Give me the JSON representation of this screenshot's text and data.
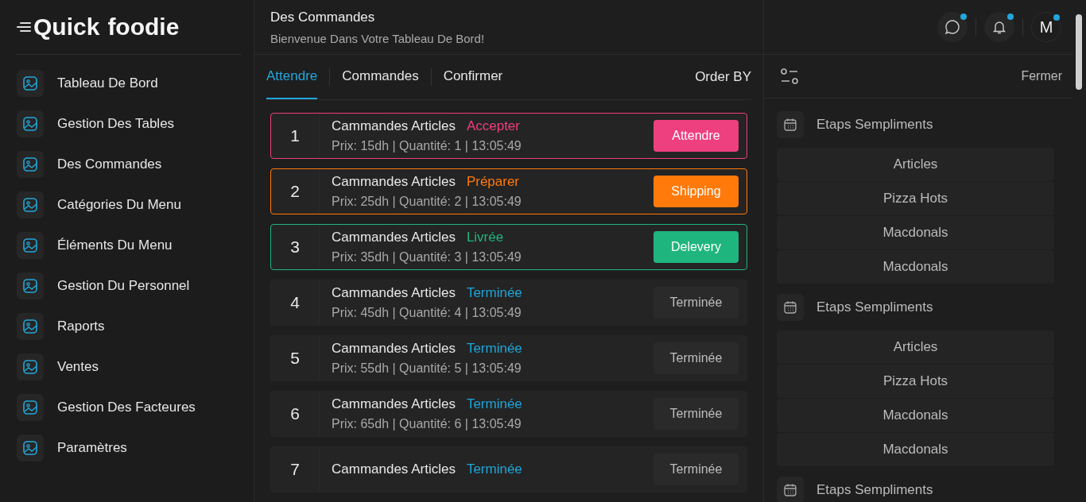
{
  "logo": {
    "first": "Quick",
    "second": "foodie"
  },
  "sidebar": {
    "items": [
      {
        "label": "Tableau De Bord"
      },
      {
        "label": "Gestion Des Tables"
      },
      {
        "label": "Des Commandes"
      },
      {
        "label": "Catégories Du Menu"
      },
      {
        "label": "Éléments Du Menu"
      },
      {
        "label": "Gestion Du Personnel"
      },
      {
        "label": "Raports"
      },
      {
        "label": "Ventes"
      },
      {
        "label": "Gestion Des Facteures"
      },
      {
        "label": "Paramètres"
      }
    ]
  },
  "header": {
    "title": "Des Commandes",
    "subtitle": "Bienvenue Dans Votre Tableau De Bord!",
    "actions": [
      {
        "kind": "chat",
        "unread": true
      },
      {
        "kind": "bell",
        "unread": true
      },
      {
        "kind": "avatar",
        "initial": "M",
        "unread": true
      }
    ]
  },
  "tabs": [
    {
      "label": "Attendre",
      "selected": true
    },
    {
      "label": "Commandes",
      "selected": false
    },
    {
      "label": "Confirmer",
      "selected": false
    }
  ],
  "order_by": "Order BY",
  "orders": [
    {
      "number": "1",
      "title": "Cammandes Articles",
      "status": "Accepter",
      "color": "#ee3f7f",
      "kind": "filled",
      "meta": "Prix: 15dh | Quantité: 1 | 13:05:49",
      "action": "Attendre"
    },
    {
      "number": "2",
      "title": "Cammandes Articles",
      "status": "Préparer",
      "color": "#ff7a0a",
      "kind": "filled",
      "meta": "Prix: 25dh | Quantité: 2 | 13:05:49",
      "action": "Shipping"
    },
    {
      "number": "3",
      "title": "Cammandes Articles",
      "status": "Livrée",
      "color": "#1fb57f",
      "kind": "filled",
      "meta": "Prix: 35dh | Quantité: 3 | 13:05:49",
      "action": "Delevery"
    },
    {
      "number": "4",
      "title": "Cammandes Articles",
      "status": "Terminée",
      "color": "#1ea5d8",
      "kind": "muted",
      "meta": "Prix: 45dh | Quantité: 4 | 13:05:49",
      "action": "Terminée"
    },
    {
      "number": "5",
      "title": "Cammandes Articles",
      "status": "Terminée",
      "color": "#1ea5d8",
      "kind": "muted",
      "meta": "Prix: 55dh | Quantité: 5 | 13:05:49",
      "action": "Terminée"
    },
    {
      "number": "6",
      "title": "Cammandes Articles",
      "status": "Terminée",
      "color": "#1ea5d8",
      "kind": "muted",
      "meta": "Prix: 65dh | Quantité: 6 | 13:05:49",
      "action": "Terminée"
    },
    {
      "number": "7",
      "title": "Cammandes Articles",
      "status": "Terminée",
      "color": "#1ea5d8",
      "kind": "muted",
      "action": "Terminée"
    }
  ],
  "panel": {
    "close": "Fermer",
    "groups": [
      {
        "title": "Etaps Sempliments",
        "items": [
          "Articles",
          "Pizza Hots",
          "Macdonals",
          "Macdonals"
        ]
      },
      {
        "title": "Etaps Sempliments",
        "items": [
          "Articles",
          "Pizza Hots",
          "Macdonals",
          "Macdonals"
        ]
      },
      {
        "title": "Etaps Sempliments"
      }
    ]
  }
}
